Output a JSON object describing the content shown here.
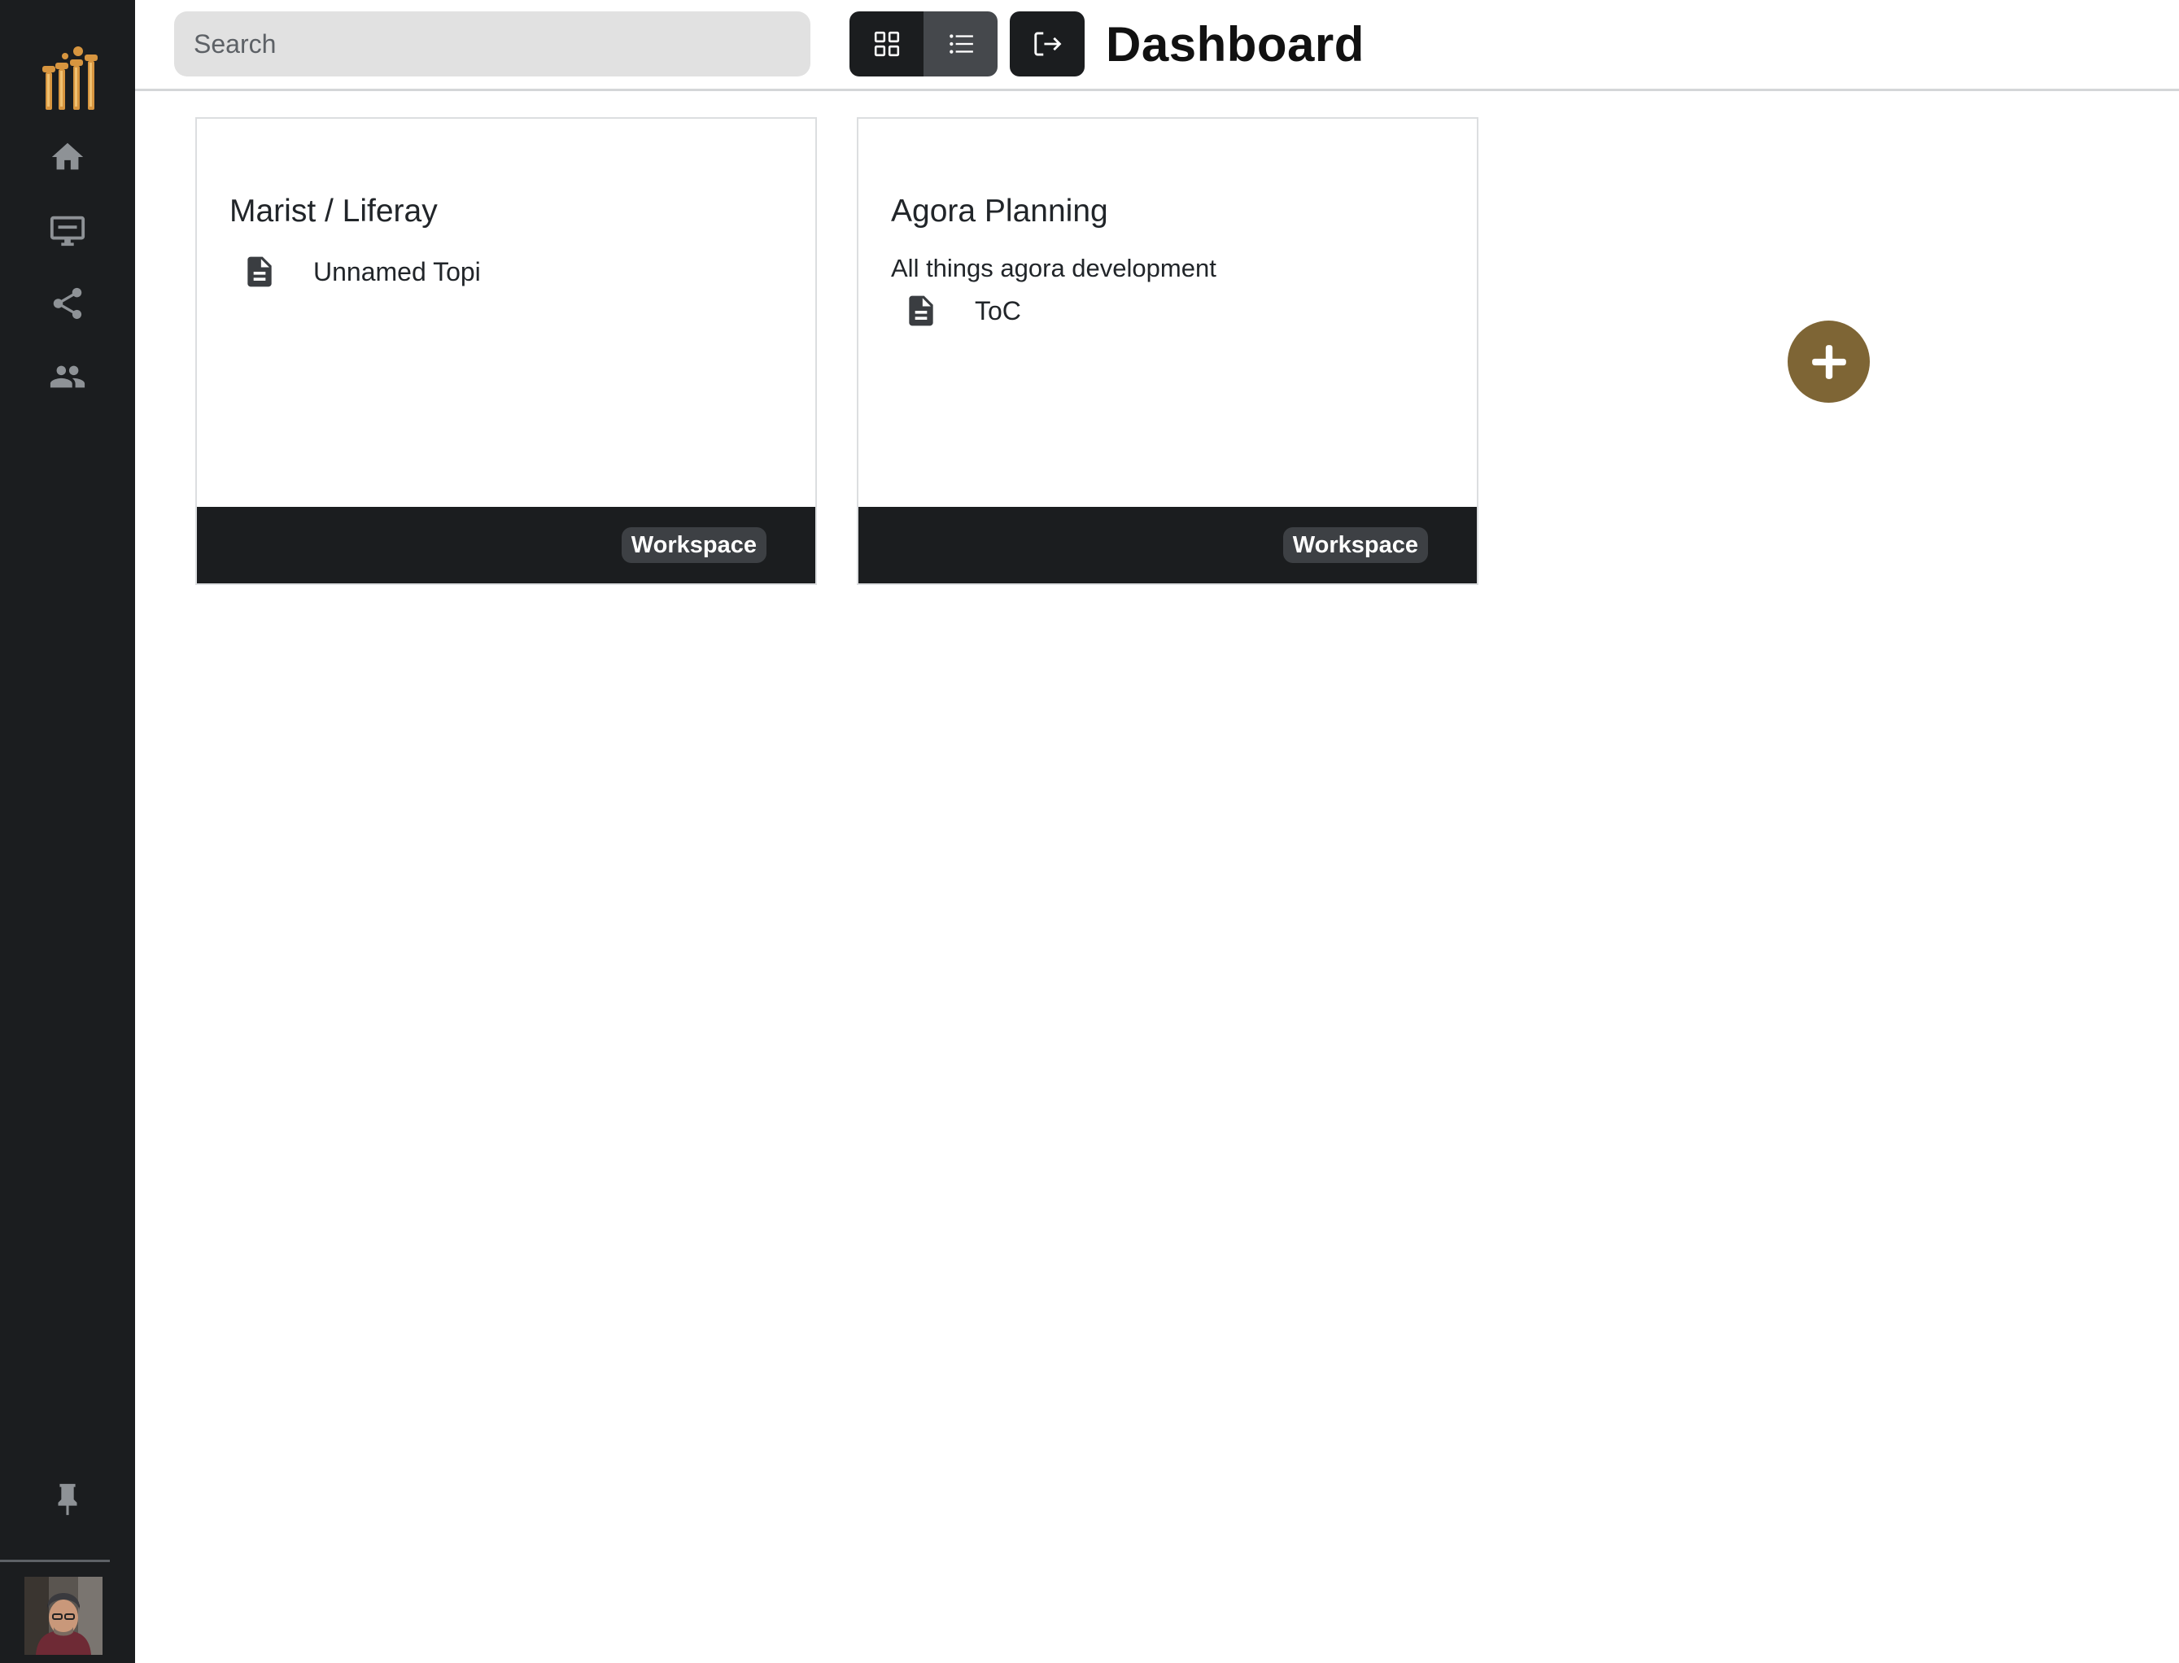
{
  "header": {
    "title": "Dashboard",
    "search_placeholder": "Search"
  },
  "sidebar": {
    "items": [
      {
        "icon": "home-icon"
      },
      {
        "icon": "monitor-icon"
      },
      {
        "icon": "share-icon"
      },
      {
        "icon": "people-icon"
      }
    ],
    "pin_icon": "pin-icon"
  },
  "toolbar": {
    "view_modes": [
      "grid-view-icon",
      "list-view-icon"
    ],
    "logout_icon": "logout-icon"
  },
  "cards": [
    {
      "title": "Marist / Liferay",
      "description": "",
      "items": [
        {
          "label": "Unnamed Topi",
          "icon": "document-icon"
        }
      ],
      "badge": "Workspace"
    },
    {
      "title": "Agora Planning",
      "description": "All things agora development",
      "items": [
        {
          "label": "ToC",
          "icon": "document-icon"
        }
      ],
      "badge": "Workspace"
    }
  ],
  "colors": {
    "sidebar_bg": "#1b1d1f",
    "accent": "#7e6535",
    "logo": "#d7953f",
    "search_bg": "#e1e1e1"
  }
}
